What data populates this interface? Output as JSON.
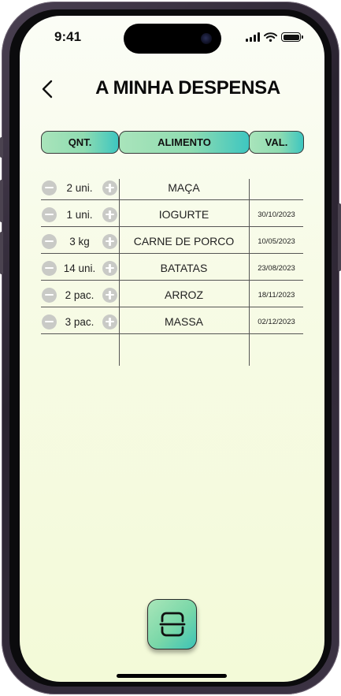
{
  "status": {
    "time": "9:41"
  },
  "header": {
    "title": "A MINHA DESPENSA"
  },
  "table": {
    "columns": [
      "QNT.",
      "ALIMENTO",
      "VAL."
    ],
    "rows": [
      {
        "qty": "2 uni.",
        "name": "MAÇA",
        "expiry": ""
      },
      {
        "qty": "1 uni.",
        "name": "IOGURTE",
        "expiry": "30/10/2023"
      },
      {
        "qty": "3 kg",
        "name": "CARNE DE PORCO",
        "expiry": "10/05/2023"
      },
      {
        "qty": "14 uni.",
        "name": "BATATAS",
        "expiry": "23/08/2023"
      },
      {
        "qty": "2 pac.",
        "name": "ARROZ",
        "expiry": "18/11/2023"
      },
      {
        "qty": "3 pac.",
        "name": "MASSA",
        "expiry": "02/12/2023"
      }
    ]
  },
  "icons": {
    "back": "chevron-left-icon",
    "decrease": "minus-circle-icon",
    "increase": "plus-circle-icon",
    "scan": "scan-icon"
  },
  "colors": {
    "accent_start": "#a9e4bb",
    "accent_end": "#3ec6c0",
    "background": "#f7fbe6"
  }
}
